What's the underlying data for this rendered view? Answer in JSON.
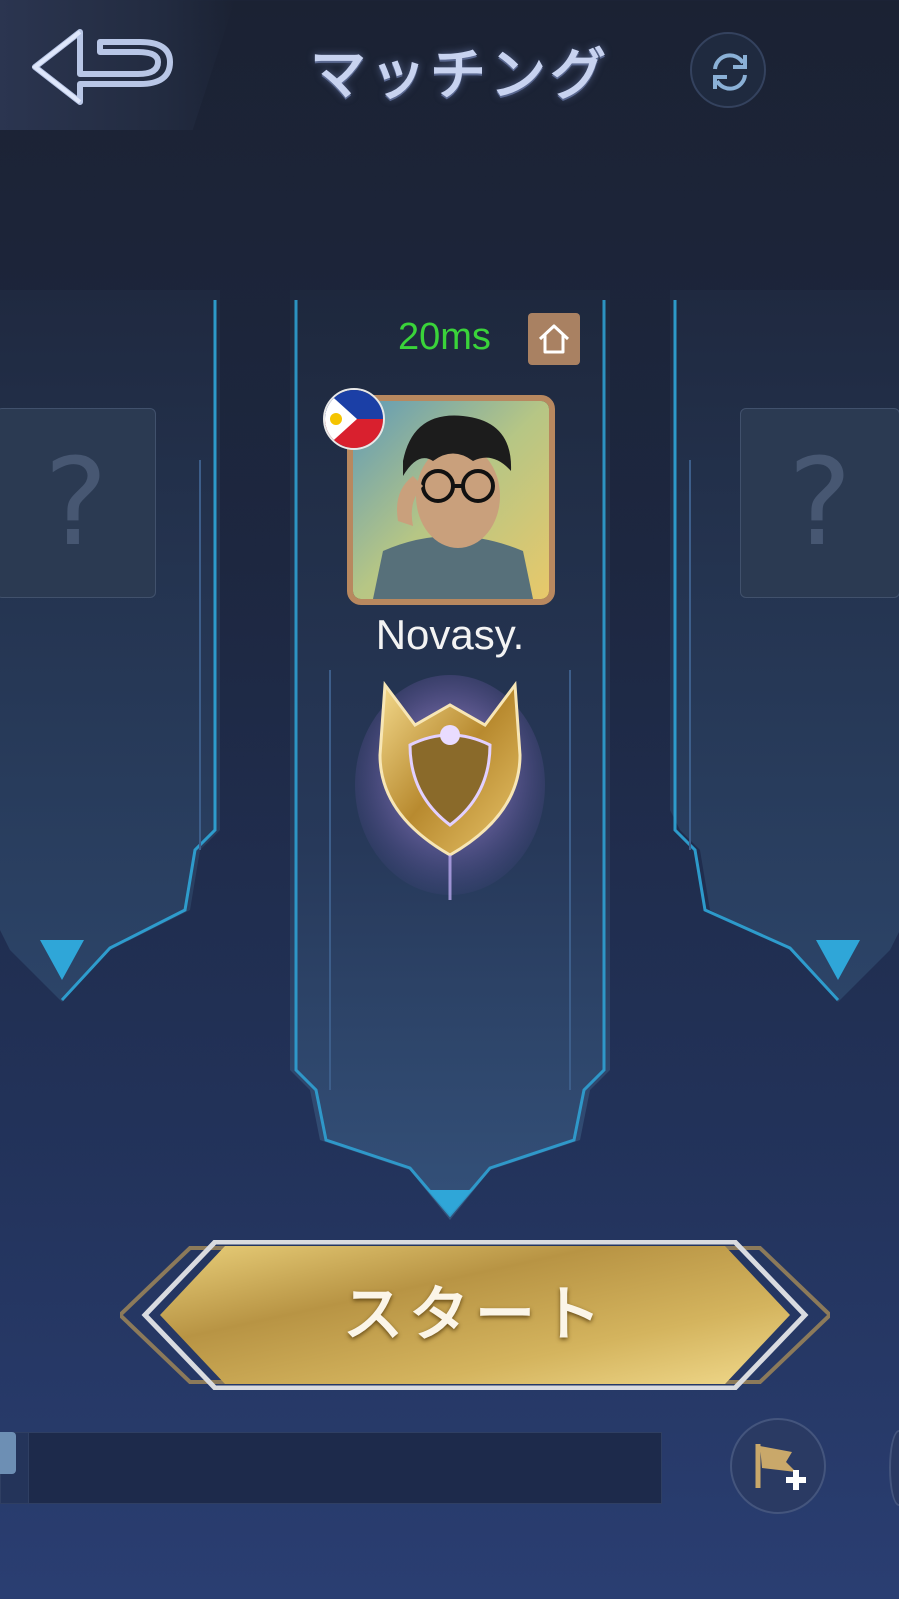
{
  "header": {
    "title": "マッチング",
    "back_icon": "back-arrow-icon",
    "refresh_icon": "refresh-icon"
  },
  "slots": {
    "left_placeholder": "?",
    "right_placeholder": "?"
  },
  "player": {
    "ping": "20ms",
    "ping_color": "#3ad33a",
    "home_icon": "home-icon",
    "country_flag": "philippines-flag-icon",
    "name": "Novasy.",
    "rank_icon": "gold-rank-emblem-icon"
  },
  "start_button": {
    "label": "スタート"
  },
  "chat": {
    "input_value": "",
    "add_flag_icon": "flag-plus-icon"
  },
  "colors": {
    "accent_blue": "#2fa6d8",
    "gold": "#c9a24a",
    "frame_bronze": "#b8885f"
  }
}
